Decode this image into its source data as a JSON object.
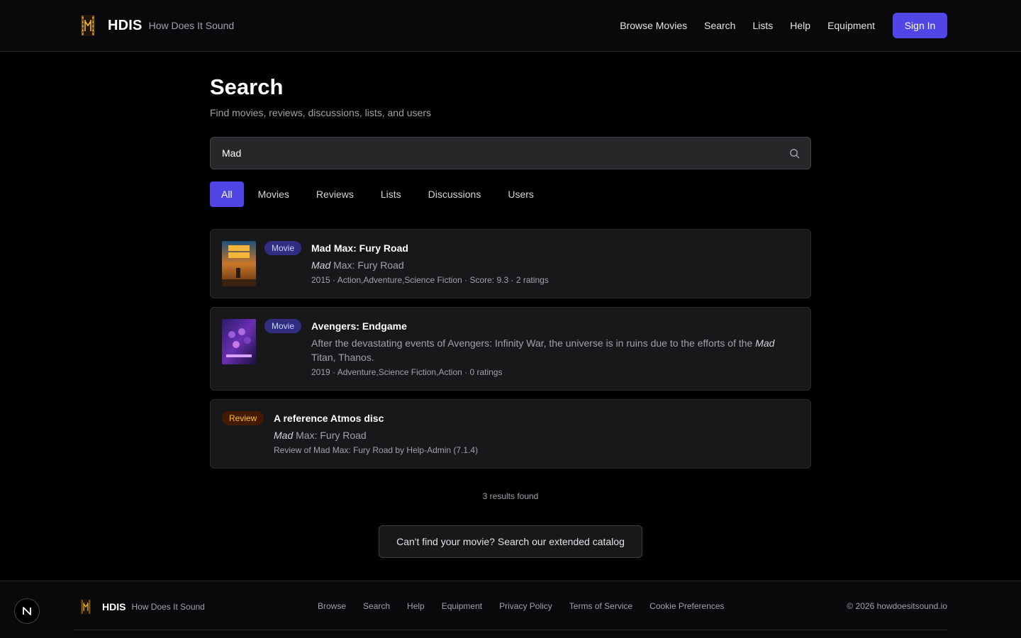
{
  "header": {
    "brand_name": "HDIS",
    "brand_tagline": "How Does It Sound",
    "nav": [
      "Browse Movies",
      "Search",
      "Lists",
      "Help",
      "Equipment"
    ],
    "sign_in": "Sign In"
  },
  "page": {
    "title": "Search",
    "subtitle": "Find movies, reviews, discussions, lists, and users"
  },
  "search": {
    "value": "Mad",
    "icon": "search-icon"
  },
  "tabs": [
    {
      "label": "All",
      "active": true
    },
    {
      "label": "Movies",
      "active": false
    },
    {
      "label": "Reviews",
      "active": false
    },
    {
      "label": "Lists",
      "active": false
    },
    {
      "label": "Discussions",
      "active": false
    },
    {
      "label": "Users",
      "active": false
    }
  ],
  "results": [
    {
      "type": "Movie",
      "title": "Mad Max: Fury Road",
      "snippet_highlight": "Mad",
      "snippet_rest": " Max: Fury Road",
      "meta": "2015 · Action,Adventure,Science Fiction · Score: 9.3 · 2 ratings"
    },
    {
      "type": "Movie",
      "title": "Avengers: Endgame",
      "snippet_before": "After the devastating events of Avengers: Infinity War, the universe is in ruins due to the efforts of the ",
      "snippet_highlight": "Mad",
      "snippet_after": " Titan, Thanos.",
      "meta": "2019 · Adventure,Science Fiction,Action · 0 ratings"
    },
    {
      "type": "Review",
      "title": "A reference Atmos disc",
      "snippet_highlight": "Mad",
      "snippet_rest": " Max: Fury Road",
      "meta": "Review of Mad Max: Fury Road by Help-Admin (7.1.4)"
    }
  ],
  "results_count": "3 results found",
  "extended_button": "Can't find your movie? Search our extended catalog",
  "footer": {
    "brand_name": "HDIS",
    "brand_tagline": "How Does It Sound",
    "links": [
      "Browse",
      "Search",
      "Help",
      "Equipment",
      "Privacy Policy",
      "Terms of Service",
      "Cookie Preferences"
    ],
    "copyright": "© 2026 howdoesitsound.io",
    "dev_badge": "N"
  },
  "colors": {
    "accent": "#4f46e5",
    "background": "#000000",
    "card": "#18181b",
    "review_badge": "#fbbf24"
  }
}
